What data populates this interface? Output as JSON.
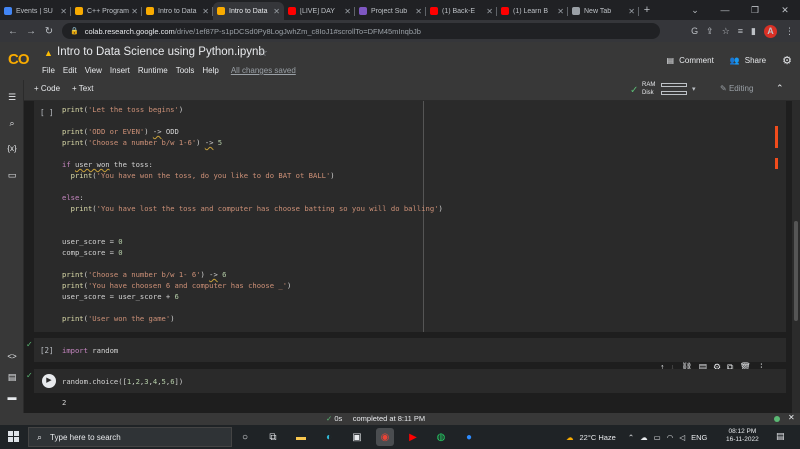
{
  "browser": {
    "tabs": [
      {
        "title": "Events | SU",
        "icon_color": "#4285f4",
        "icon": "events-icon"
      },
      {
        "title": "C++ Programming",
        "icon_color": "#f9ab00",
        "icon": "cpp-icon"
      },
      {
        "title": "Intro to Data",
        "icon_color": "#f9ab00",
        "icon": "colab-icon"
      },
      {
        "title": "Intro to Data",
        "icon_color": "#f9ab00",
        "icon": "colab-icon",
        "active": true
      },
      {
        "title": "[LIVE] DAY",
        "icon_color": "#ff0000",
        "icon": "youtube-icon"
      },
      {
        "title": "Project Sub",
        "icon_color": "#7e57c2",
        "icon": "project-icon"
      },
      {
        "title": "(1) Back-E",
        "icon_color": "#ff0000",
        "icon": "youtube-icon"
      },
      {
        "title": "(1) Learn B",
        "icon_color": "#ff0000",
        "icon": "youtube-icon"
      },
      {
        "title": "New Tab",
        "icon_color": "#9aa0a6",
        "icon": "chrome-icon"
      }
    ],
    "url_domain": "colab.research.google.com",
    "url_path": "/drive/1ef87P-s1pDCSd0Py8LogJwhZm_c8IoJ1#scrollTo=DFM45mInqbJb",
    "avatar_letter": "A"
  },
  "colab": {
    "title": "Intro to Data Science using Python.ipynb",
    "menu": [
      "File",
      "Edit",
      "View",
      "Insert",
      "Runtime",
      "Tools",
      "Help"
    ],
    "saved_status": "All changes saved",
    "comment_label": "Comment",
    "share_label": "Share",
    "add_code": "+ Code",
    "add_text": "+ Text",
    "ram_label": "RAM",
    "disk_label": "Disk",
    "editing_label": "Editing"
  },
  "cells": {
    "cell1_prompt": "[ ]",
    "cell1_lines": [
      "print('Let the toss begins')",
      "",
      "print('ODD or EVEN') -> ODD",
      "print('Choose a number b/w 1-6') -> 5",
      "",
      "if user won the toss:",
      "  print('You have won the toss, do you like to do BAT ot BALL')",
      "",
      "else:",
      "  print('You have lost the toss and computer has choose batting so you will do balling')",
      "",
      "",
      "user_score = 0",
      "comp_score = 0",
      "",
      "print('Choose a number b/w 1- 6') -> 6",
      "print('You have choosen 6 and computer has choose _')",
      "user_score = user_score + 6",
      "",
      "print('User won the game')"
    ],
    "cell2_prompt": "[2]",
    "cell2_code": "import random",
    "cell3_code": "random.choice([1,2,3,4,5,6])",
    "cell3_output": "2"
  },
  "status": {
    "exec_time": "0s",
    "completed": "completed at 8:11 PM"
  },
  "taskbar": {
    "search_placeholder": "Type here to search",
    "weather": "22°C  Haze",
    "lang": "ENG",
    "time": "08:12 PM",
    "date": "16-11-2022"
  },
  "colors": {
    "accent_orange": "#f9ab00",
    "ok_green": "#5bb974",
    "error_marker": "#f14c1c"
  }
}
